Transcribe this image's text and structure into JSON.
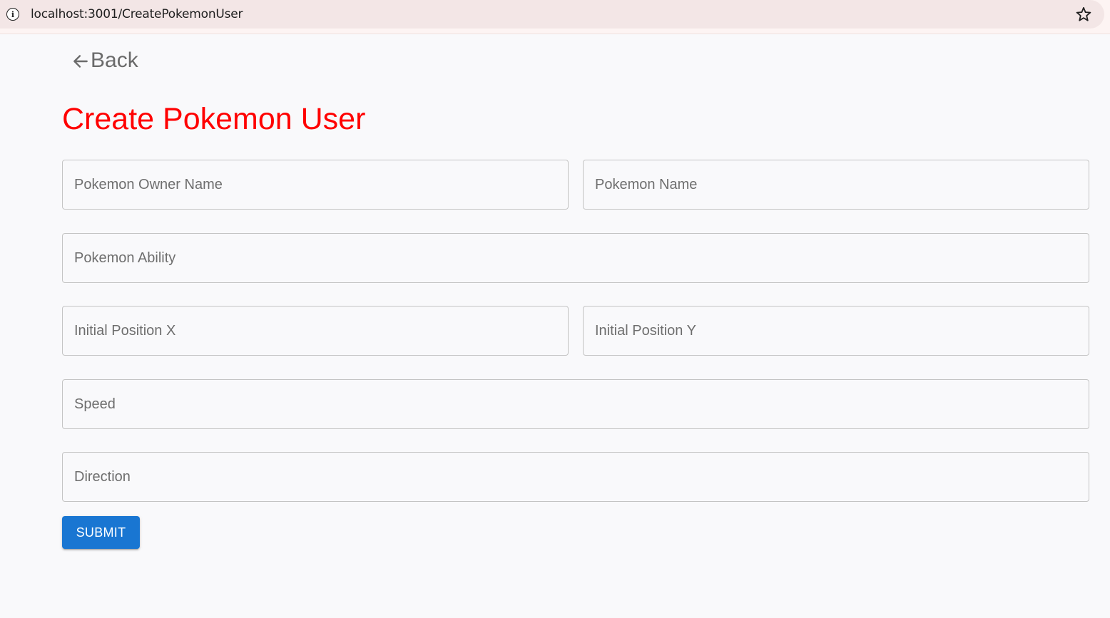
{
  "browser": {
    "url": "localhost:3001/CreatePokemonUser",
    "info_icon": "info-icon",
    "bookmark_icon": "star-outline-icon"
  },
  "nav": {
    "back_label": "Back",
    "back_icon": "arrow-left-icon"
  },
  "page": {
    "title": "Create Pokemon User",
    "title_color": "#ff0000"
  },
  "form": {
    "owner_name": {
      "placeholder": "Pokemon Owner Name",
      "value": ""
    },
    "pokemon_name": {
      "placeholder": "Pokemon Name",
      "value": ""
    },
    "ability": {
      "placeholder": "Pokemon Ability",
      "value": ""
    },
    "initial_x": {
      "placeholder": "Initial Position X",
      "value": ""
    },
    "initial_y": {
      "placeholder": "Initial Position Y",
      "value": ""
    },
    "speed": {
      "placeholder": "Speed",
      "value": ""
    },
    "direction": {
      "placeholder": "Direction",
      "value": ""
    },
    "submit_label": "SUBMIT",
    "submit_color": "#1976d2"
  }
}
